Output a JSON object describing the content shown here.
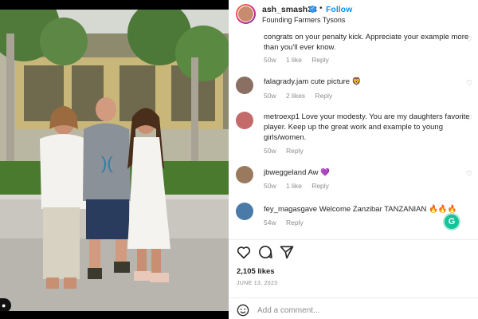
{
  "post": {
    "username": "ash_smash33",
    "verified_icon": "verified-badge-icon",
    "separator": "•",
    "follow_label": "Follow",
    "subtitle": "Founding Farmers Tysons",
    "likes": "2,105 likes",
    "date": "JUNE 13, 2023"
  },
  "comments": [
    {
      "text": "congrats on your penalty kick. Appreciate your example more than you'll ever know.",
      "time": "50w",
      "likes": "1 like",
      "reply": "Reply",
      "avatar_color": "#b58a6a"
    },
    {
      "user": "falagrady.jam",
      "text": "cute picture 🦁",
      "time": "50w",
      "likes": "2 likes",
      "reply": "Reply",
      "avatar_color": "#8a6f62"
    },
    {
      "user": "metroexp1",
      "text": "Love your modesty. You are my daughters favorite player. Keep up the great work and example to young girls/women.",
      "time": "50w",
      "reply": "Reply",
      "avatar_color": "#c46a6a"
    },
    {
      "user": "jbweggeland",
      "text": "Aw 💜",
      "time": "50w",
      "likes": "1 like",
      "reply": "Reply",
      "avatar_color": "#9a7a5e"
    },
    {
      "user": "fey_magasgave",
      "text": "Welcome Zanzibar TANZANIAN 🔥🔥🔥",
      "time": "54w",
      "reply": "Reply",
      "avatar_color": "#4a7aa8"
    }
  ],
  "actions": {
    "like_icon": "heart-icon",
    "comment_icon": "comment-icon",
    "share_icon": "share-icon",
    "comment_small_heart": "heart-icon"
  },
  "add_comment": {
    "placeholder": "Add a comment...",
    "emoji_icon": "emoji-icon"
  },
  "grammarly": {
    "label": "G"
  },
  "colors": {
    "link_blue": "#0095f6",
    "text": "#262626",
    "muted": "#8e8e8e",
    "border": "#efefef"
  }
}
